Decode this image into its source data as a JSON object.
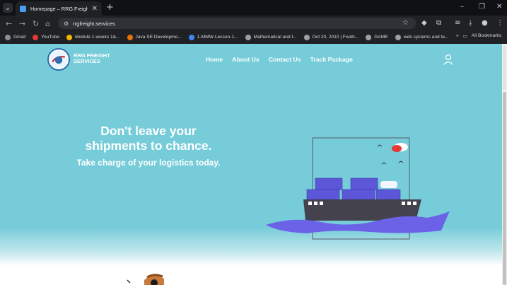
{
  "browser": {
    "tab_title": "Homepage – RRG Freight Servi",
    "url": "rrgfreight.services",
    "bookmarks": [
      "Gmail",
      "YouTube",
      "Module 1-weeks 1&...",
      "Java SE Developme...",
      "1-MMW-Lesson-1...",
      "Mathematical and t...",
      "Oct 20, 2010 | Footh...",
      "GAME",
      "web systems and te..."
    ],
    "all_bookmarks": "All Bookmarks"
  },
  "site": {
    "brand_line1": "RRG FREIGHT",
    "brand_line2": "SERVICES",
    "nav": [
      "Home",
      "About Us",
      "Contact Us",
      "Track Package"
    ],
    "hero_line1": "Don't leave your",
    "hero_line2": "shipments to chance.",
    "hero_sub": "Take charge of your logistics today."
  }
}
